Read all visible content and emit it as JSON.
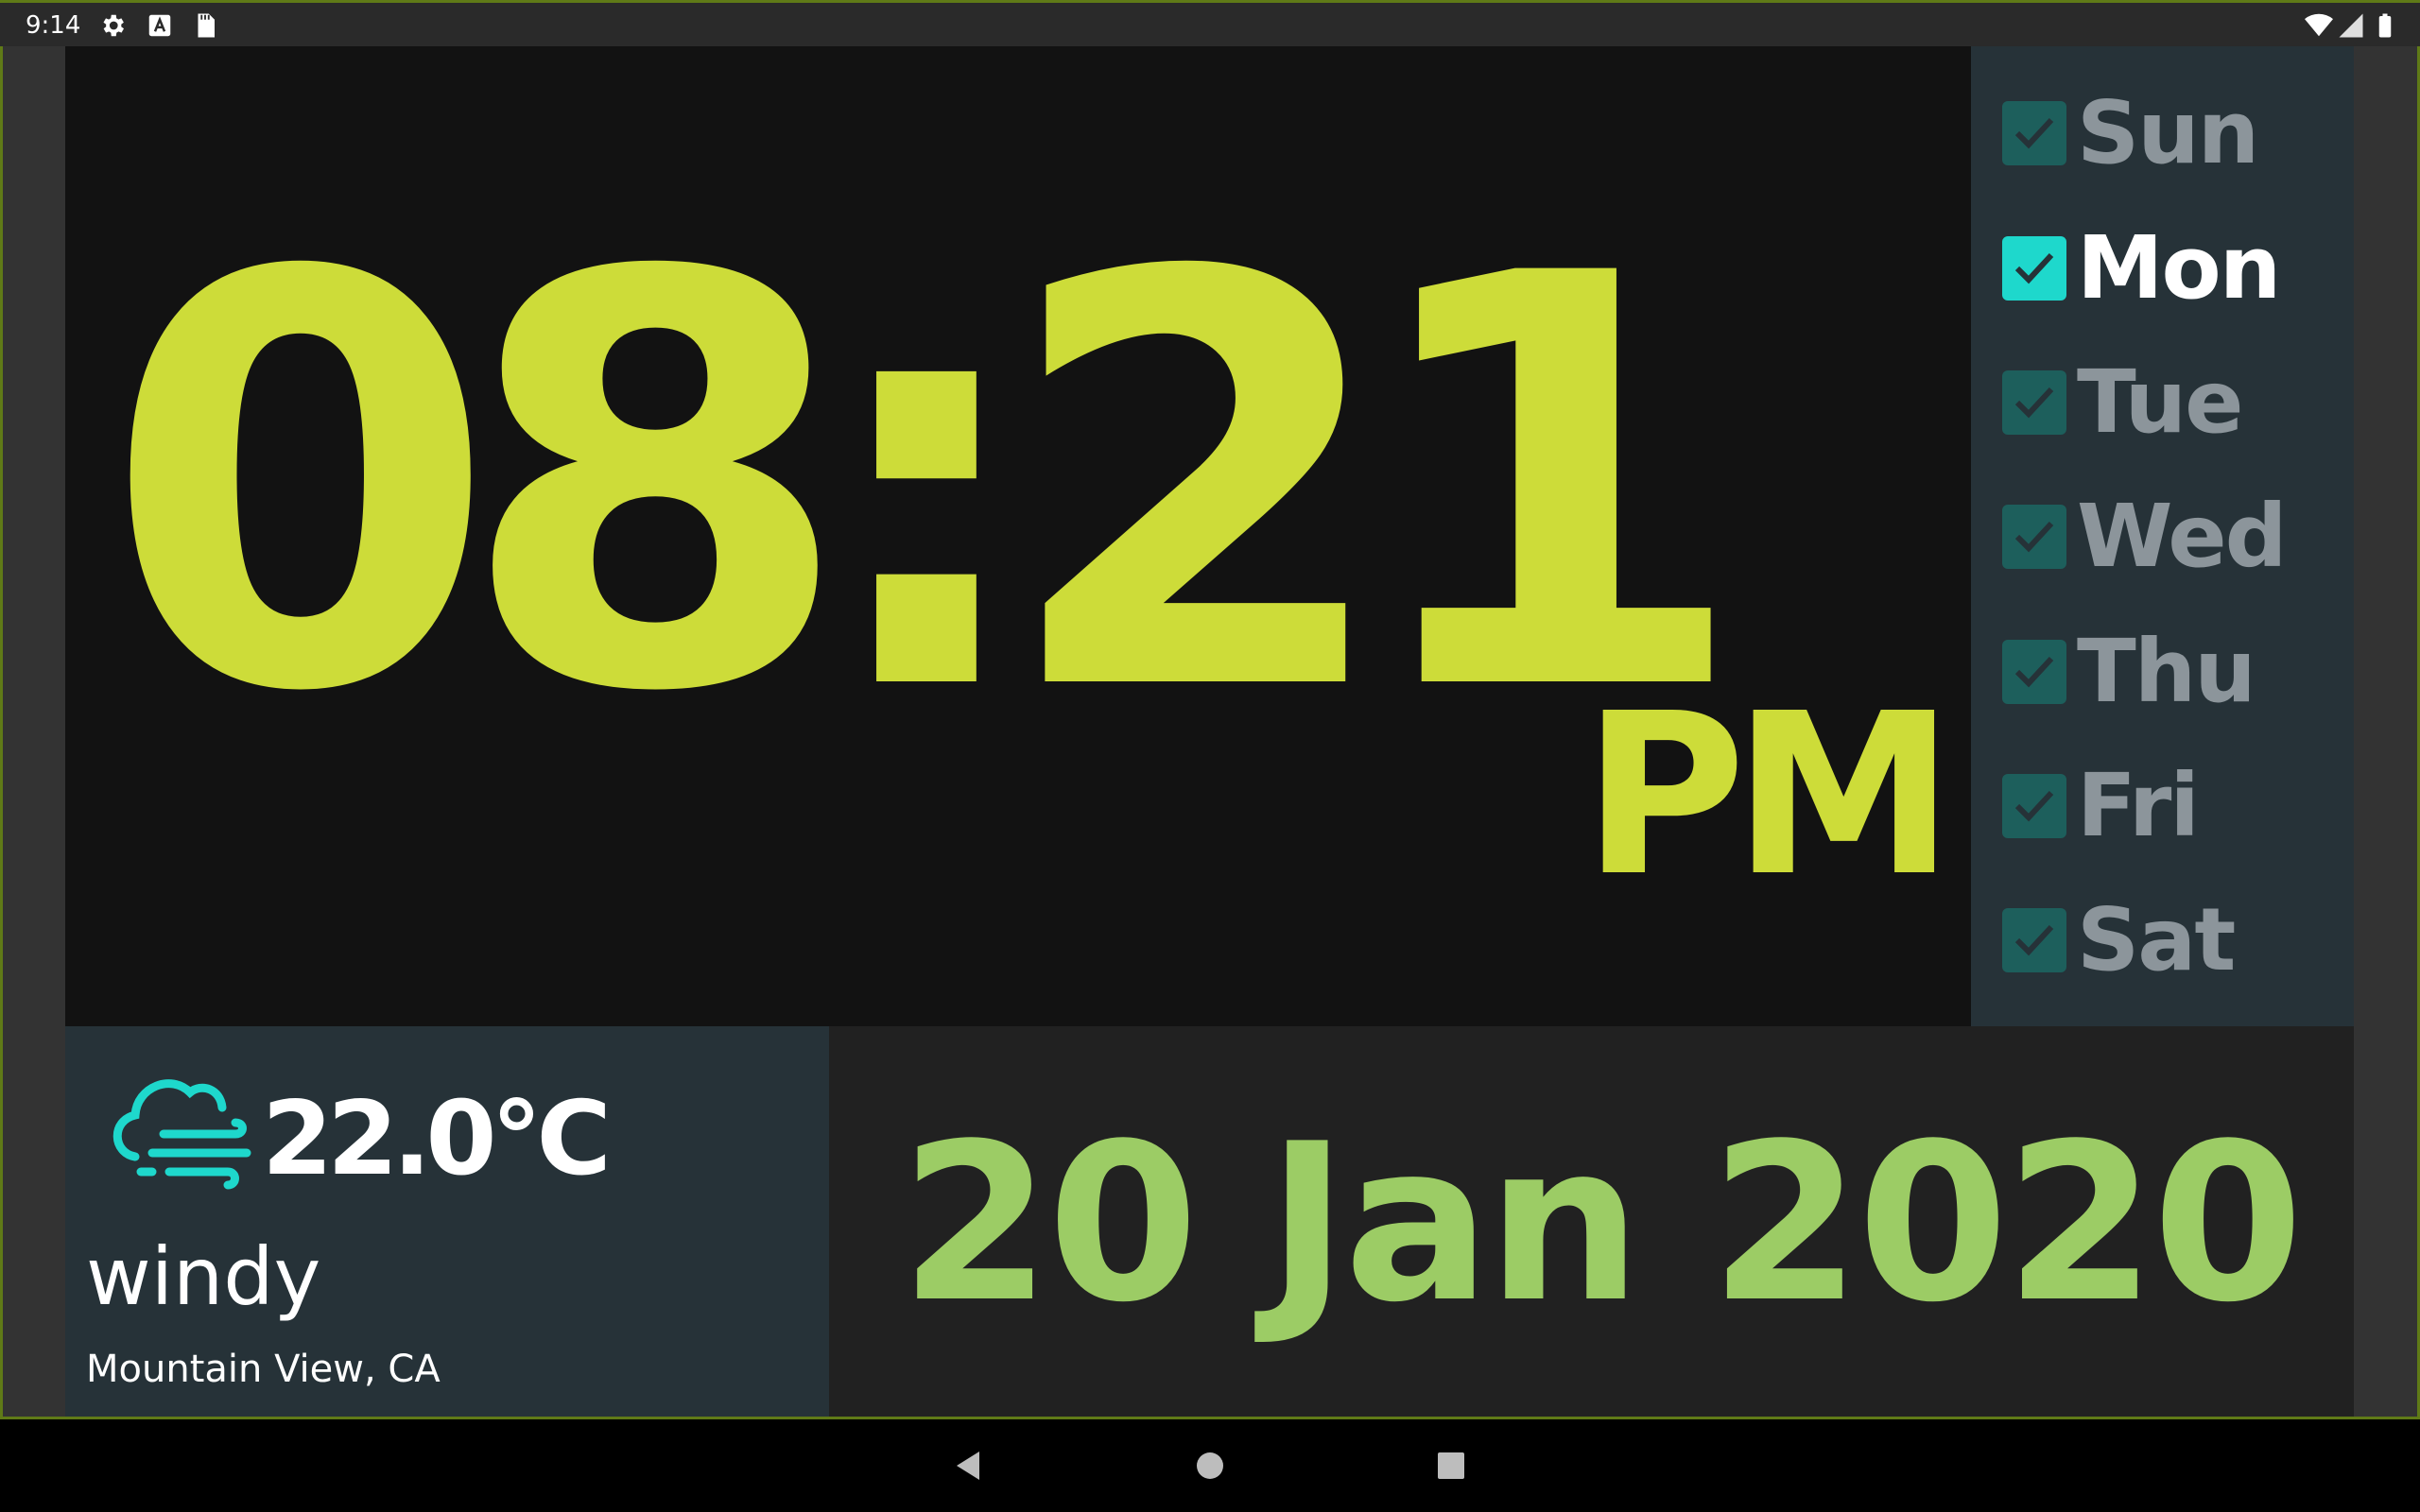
{
  "status_bar": {
    "time": "9:14",
    "icons": [
      "settings-icon",
      "keyboard-a-icon",
      "sd-card-icon",
      "wifi-icon",
      "signal-icon",
      "battery-icon"
    ]
  },
  "clock": {
    "time": "08:21",
    "meridiem": "PM",
    "color": "#cddc39"
  },
  "days": [
    {
      "label": "Sun",
      "checked": true,
      "active": false
    },
    {
      "label": "Mon",
      "checked": true,
      "active": true
    },
    {
      "label": "Tue",
      "checked": true,
      "active": false
    },
    {
      "label": "Wed",
      "checked": true,
      "active": false
    },
    {
      "label": "Thu",
      "checked": true,
      "active": false
    },
    {
      "label": "Fri",
      "checked": true,
      "active": false
    },
    {
      "label": "Sat",
      "checked": true,
      "active": false
    }
  ],
  "weather": {
    "icon": "windy-cloud-icon",
    "temperature": "22.0°C",
    "condition": "windy",
    "location": "Mountain View, CA"
  },
  "date": {
    "text": "20 Jan 2020",
    "color": "#9ccc65"
  },
  "navigation": {
    "back": "back-icon",
    "home": "home-icon",
    "recents": "recents-icon"
  }
}
